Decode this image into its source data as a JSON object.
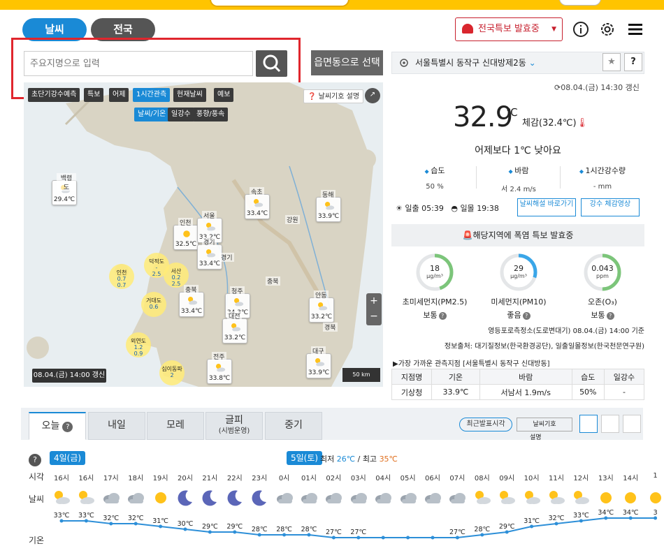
{
  "tabs": {
    "weather": "날씨",
    "nationwide": "전국"
  },
  "alert_button": "전국특보 발효중",
  "search": {
    "placeholder": "주요지명으로 입력",
    "emd_button": "읍면동으로 선택"
  },
  "map": {
    "buttons": [
      "초단기강수예측",
      "특보",
      "어제",
      "1시간관측",
      "현재날씨",
      "예보"
    ],
    "sub_buttons": [
      "날씨/기온",
      "일강수",
      "풍향/풍속"
    ],
    "legend_btn": "날씨기호 설명",
    "stamp": "08.04.(금) 14:00 갱신",
    "scale": "50 km",
    "zoom_in": "+",
    "zoom_out": "−",
    "cards": [
      {
        "name": "백령도",
        "temp": "29.4℃",
        "icon": "partly-cloudy"
      },
      {
        "name": "속초",
        "temp": "33.4℃",
        "icon": "partly-cloudy"
      },
      {
        "name": "동해",
        "temp": "33.9℃",
        "icon": "partly-cloudy"
      },
      {
        "name": "인천",
        "temp": "32.5℃",
        "icon": "sunny"
      },
      {
        "name": "서울",
        "temp": "33.2℃",
        "icon": "partly-cloudy"
      },
      {
        "name": "경기",
        "temp": "33.4℃",
        "icon": "partly-cloudy"
      },
      {
        "name": "충북",
        "temp": "33.4℃",
        "icon": "partly-cloudy"
      },
      {
        "name": "청주",
        "temp": "34.3℃",
        "icon": "partly-cloudy"
      },
      {
        "name": "대전",
        "temp": "33.2℃",
        "icon": "partly-cloudy"
      },
      {
        "name": "안동",
        "temp": "33.2℃",
        "icon": "partly-cloudy"
      },
      {
        "name": "전주",
        "temp": "33.8℃",
        "icon": "partly-cloudy"
      },
      {
        "name": "대구",
        "temp": "33.9℃",
        "icon": "partly-cloudy"
      }
    ],
    "city_labels": [
      "강원",
      "충북",
      "경북",
      "경기"
    ],
    "wind": [
      {
        "name": "인천",
        "v1": "0.7",
        "v2": "0.7"
      },
      {
        "name": "덕적도",
        "v1": "-",
        "v2": "2.5"
      },
      {
        "name": "서산",
        "v1": "0.2",
        "v2": "2.5"
      },
      {
        "name": "거대도",
        "v1": "0.6",
        "v2": ""
      },
      {
        "name": "외연도",
        "v1": "1.2",
        "v2": "0.9"
      },
      {
        "name": "십이동파",
        "v1": "2",
        "v2": ""
      }
    ]
  },
  "panel": {
    "location": "서울특별시 동작구 신대방제2동",
    "updated": "08.04.(금) 14:30 갱신",
    "temperature": "32.9",
    "unit": "℃",
    "feels_like": "체감(32.4℃)",
    "compare": "어제보다 1℃ 낮아요",
    "stats": [
      {
        "label": "습도",
        "value": "50 %"
      },
      {
        "label": "바람",
        "value": "서 2.4 m/s"
      },
      {
        "label": "1시간강수량",
        "value": "- mm"
      }
    ],
    "sunrise_label": "일출",
    "sunrise": "05:39",
    "sunset_label": "일몰",
    "sunset": "19:38",
    "btn_guide": "날씨해설 바로가기",
    "btn_video": "강수 체감영상",
    "warning": "해당지역에 폭염 특보 발효중",
    "air": [
      {
        "value": "18",
        "unit": "μg/m³",
        "label": "초미세먼지(PM2.5)",
        "grade": "보통",
        "fraction": 0.45,
        "color": "#7cc57a"
      },
      {
        "value": "29",
        "unit": "μg/m³",
        "label": "미세먼지(PM10)",
        "grade": "좋음",
        "fraction": 0.3,
        "color": "#3aa6e8"
      },
      {
        "value": "0.043",
        "unit": "ppm",
        "label": "오존(O₃)",
        "grade": "보통",
        "fraction": 0.5,
        "color": "#7cc57a"
      }
    ],
    "station": "영등포로측정소(도로변대기) 08.04.(금) 14:00 기준",
    "source": "정보출처: 대기질정보(한국환경공단), 일출일몰정보(한국천문연구원)",
    "near_title": "▶가장 가까운 관측지점 [서울특별시 동작구 신대방동]",
    "near_headers": [
      "지점명",
      "기온",
      "바람",
      "습도",
      "일강수"
    ],
    "near_row": [
      "기상청",
      "33.9℃",
      "서남서 1.9m/s",
      "50%",
      "-"
    ]
  },
  "forecast": {
    "tabs": [
      "오늘",
      "내일",
      "모레",
      "글피",
      "중기"
    ],
    "tab_sub": "(시범운영)",
    "recent": "최근발표시각",
    "symbol": "날씨기호",
    "note": "설명",
    "day1": "4일(금)",
    "day2": "5일(토)",
    "day2_min_label": "최저",
    "day2_min": "26℃",
    "day2_max_label": "최고",
    "day2_max": "35℃",
    "row_time": "시각",
    "row_weather": "날씨",
    "row_temp": "기온",
    "hours": [
      "16시",
      "16시",
      "17시",
      "18시",
      "19시",
      "20시",
      "21시",
      "22시",
      "23시",
      "0시",
      "01시",
      "02시",
      "03시",
      "04시",
      "05시",
      "06시",
      "07시",
      "08시",
      "09시",
      "10시",
      "11시",
      "12시",
      "13시",
      "14시",
      "1"
    ],
    "icons": [
      "partly-sunny",
      "partly-sunny",
      "cloudy",
      "cloudy",
      "sunny",
      "moon",
      "moon",
      "moon",
      "moon",
      "cloudy",
      "cloudy",
      "cloudy",
      "cloudy",
      "cloudy",
      "cloudy",
      "cloudy",
      "cloudy",
      "partly-sunny",
      "partly-sunny",
      "partly-sunny",
      "partly-sunny",
      "partly-sunny",
      "sunny",
      "sunny",
      "sunny"
    ],
    "temps": [
      33,
      33,
      32,
      32,
      31,
      30,
      29,
      29,
      28,
      28,
      28,
      27,
      27,
      27,
      27,
      27,
      27,
      28,
      29,
      31,
      32,
      33,
      34,
      34,
      34
    ],
    "temp_labels": [
      "33℃",
      "33℃",
      "32℃",
      "32℃",
      "31℃",
      "30℃",
      "29℃",
      "29℃",
      "28℃",
      "28℃",
      "28℃",
      "27℃",
      "27℃",
      "",
      "",
      "",
      "27℃",
      "28℃",
      "29℃",
      "31℃",
      "32℃",
      "33℃",
      "34℃",
      "34℃",
      "3"
    ]
  }
}
